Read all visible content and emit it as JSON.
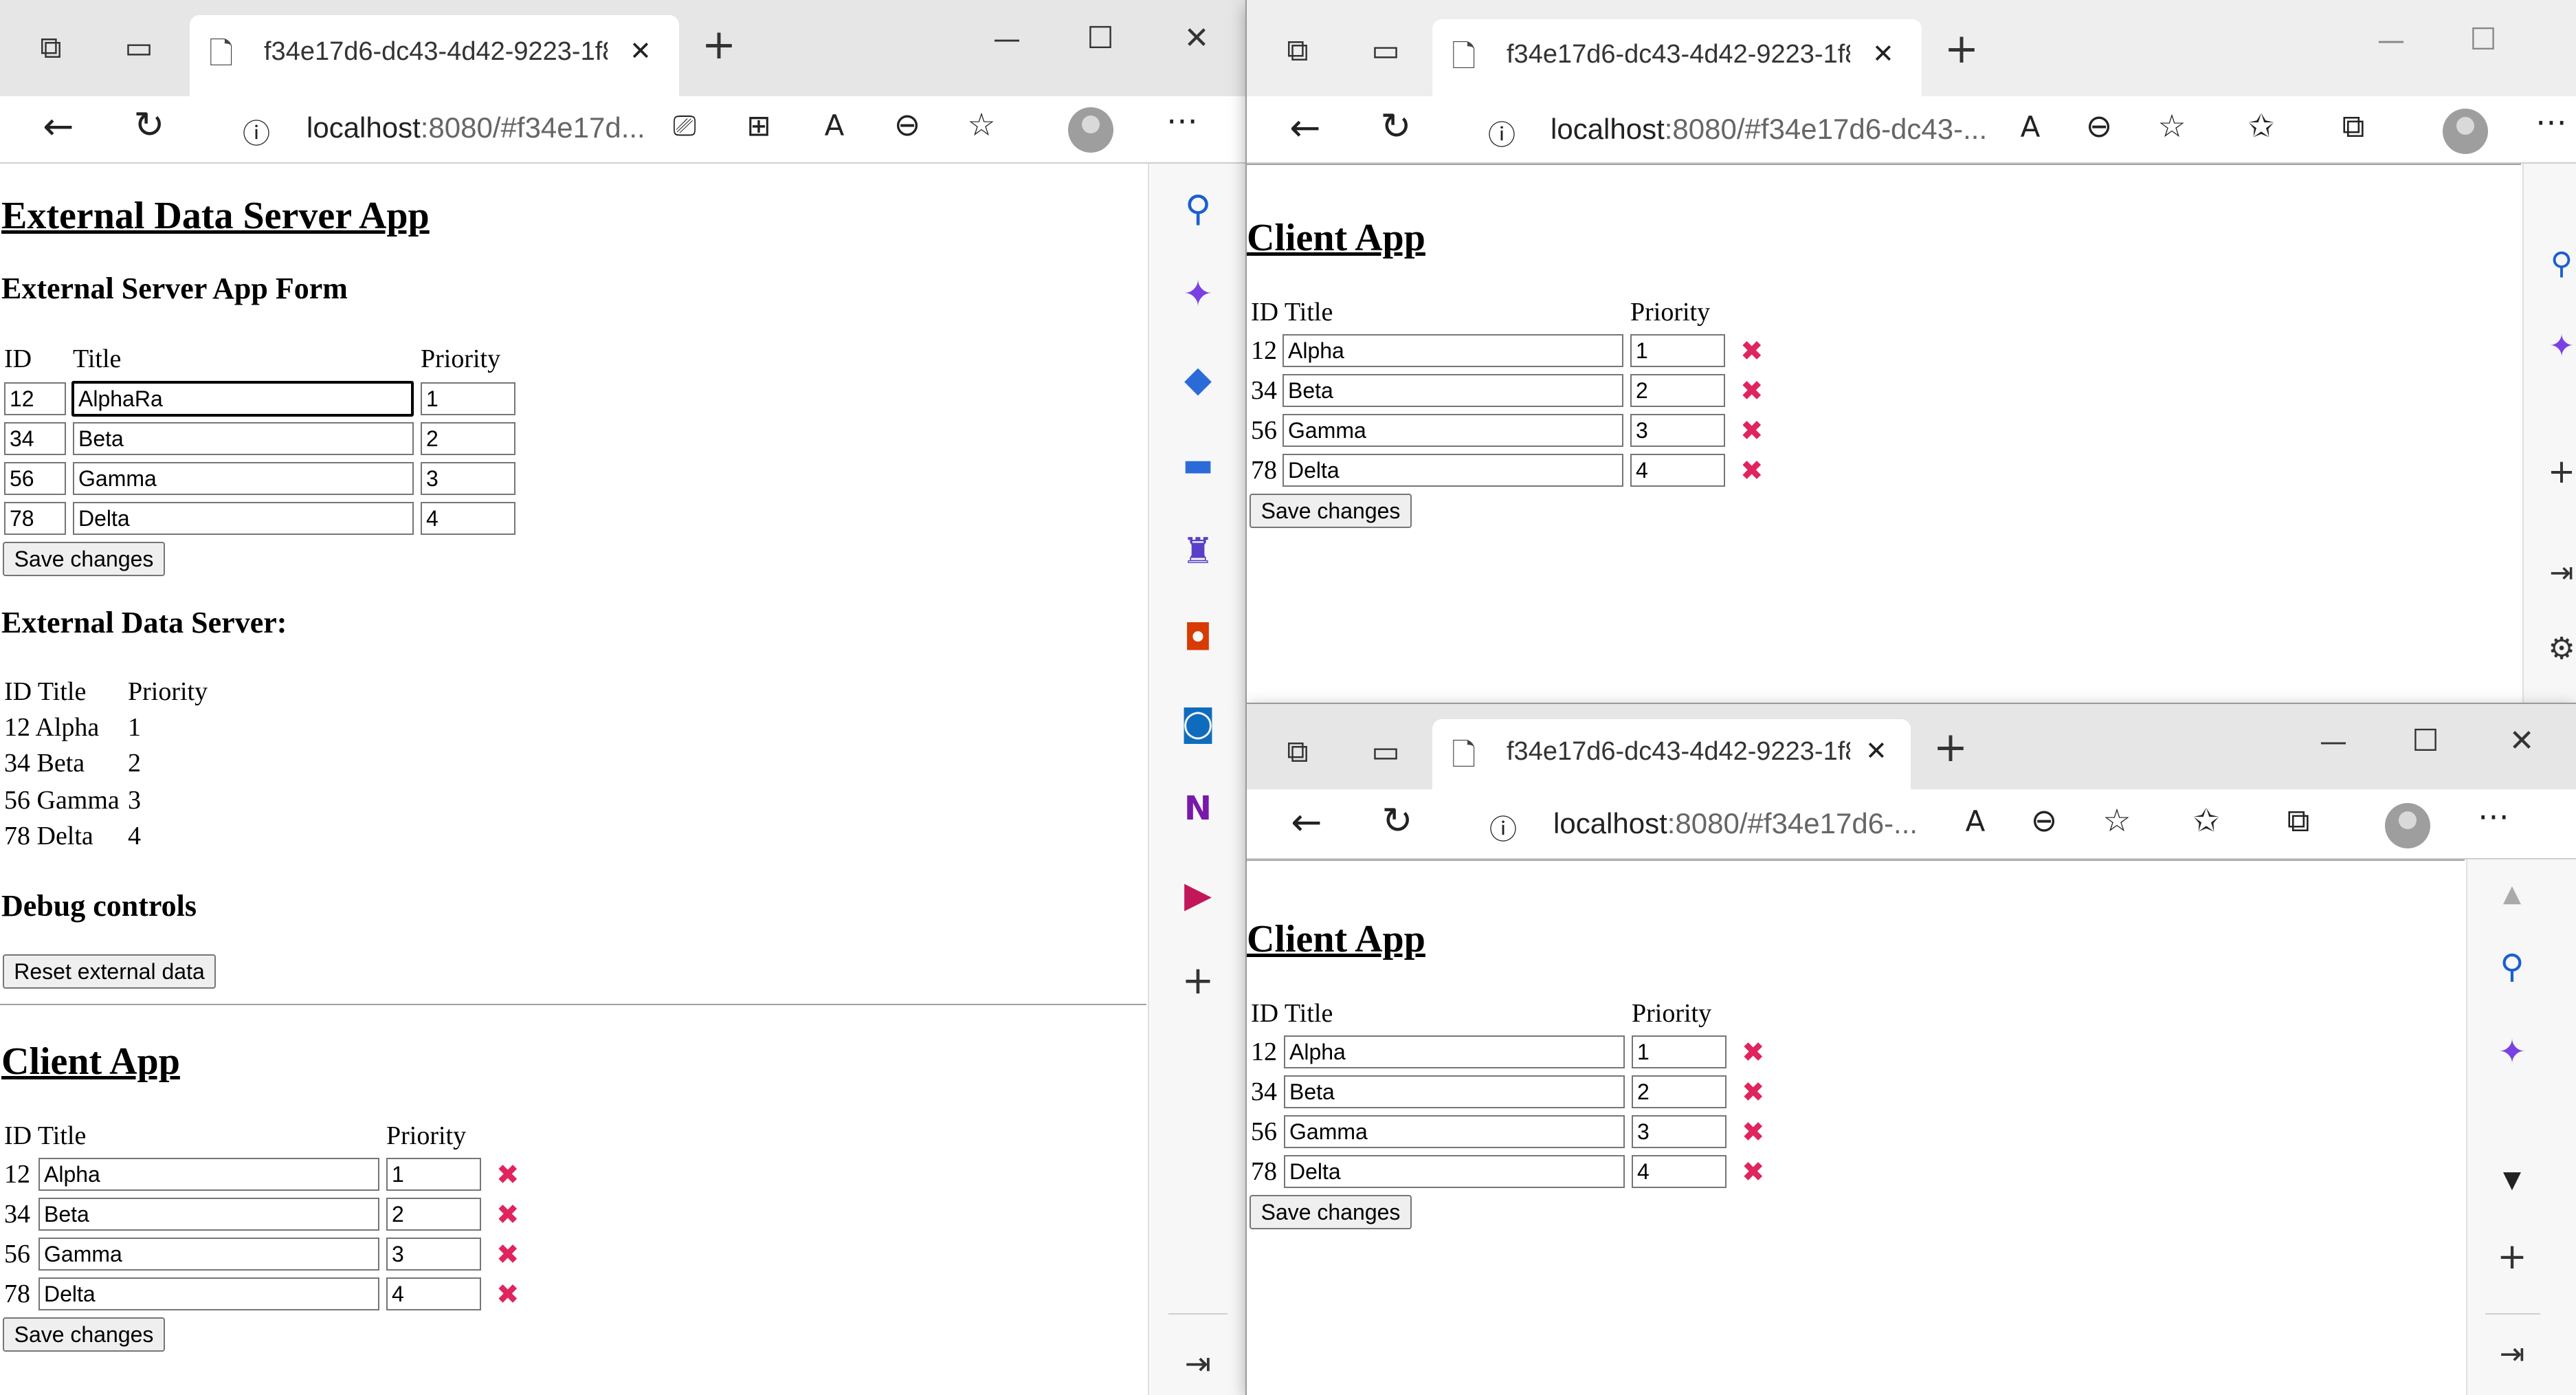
{
  "browser": {
    "tab_title": "f34e17d6-dc43-4d42-9223-1f8e",
    "url_host": "localhost",
    "url_rest_main": ":8080/#f34e17d...",
    "url_rest_tr": ":8080/#f34e17d6-dc43-...",
    "url_rest_br": ":8080/#f34e17d6-...",
    "new_tab": "+",
    "close": "✕",
    "minimize": "—",
    "maximize": "☐"
  },
  "server_app": {
    "title": "External Data Server App",
    "form_heading": "External Server App Form",
    "col_id": "ID",
    "col_title": "Title",
    "col_priority": "Priority",
    "rows": [
      {
        "id": "12",
        "title": "AlphaRa",
        "priority": "1"
      },
      {
        "id": "34",
        "title": "Beta",
        "priority": "2"
      },
      {
        "id": "56",
        "title": "Gamma",
        "priority": "3"
      },
      {
        "id": "78",
        "title": "Delta",
        "priority": "4"
      }
    ],
    "save_label": "Save changes",
    "data_heading": "External Data Server:",
    "data_header": "ID Title",
    "data_header_priority": "Priority",
    "data_rows": [
      {
        "id_title": "12 Alpha",
        "priority": "1"
      },
      {
        "id_title": "34 Beta",
        "priority": "2"
      },
      {
        "id_title": "56 Gamma",
        "priority": "3"
      },
      {
        "id_title": "78 Delta",
        "priority": "4"
      }
    ],
    "debug_heading": "Debug controls",
    "reset_label": "Reset external data"
  },
  "client_app": {
    "title": "Client App",
    "header_id_title": "ID Title",
    "header_priority": "Priority",
    "rows": [
      {
        "id": "12",
        "title": "Alpha",
        "priority": "1"
      },
      {
        "id": "34",
        "title": "Beta",
        "priority": "2"
      },
      {
        "id": "56",
        "title": "Gamma",
        "priority": "3"
      },
      {
        "id": "78",
        "title": "Delta",
        "priority": "4"
      }
    ],
    "delete_glyph": "✖",
    "save_label": "Save changes"
  }
}
